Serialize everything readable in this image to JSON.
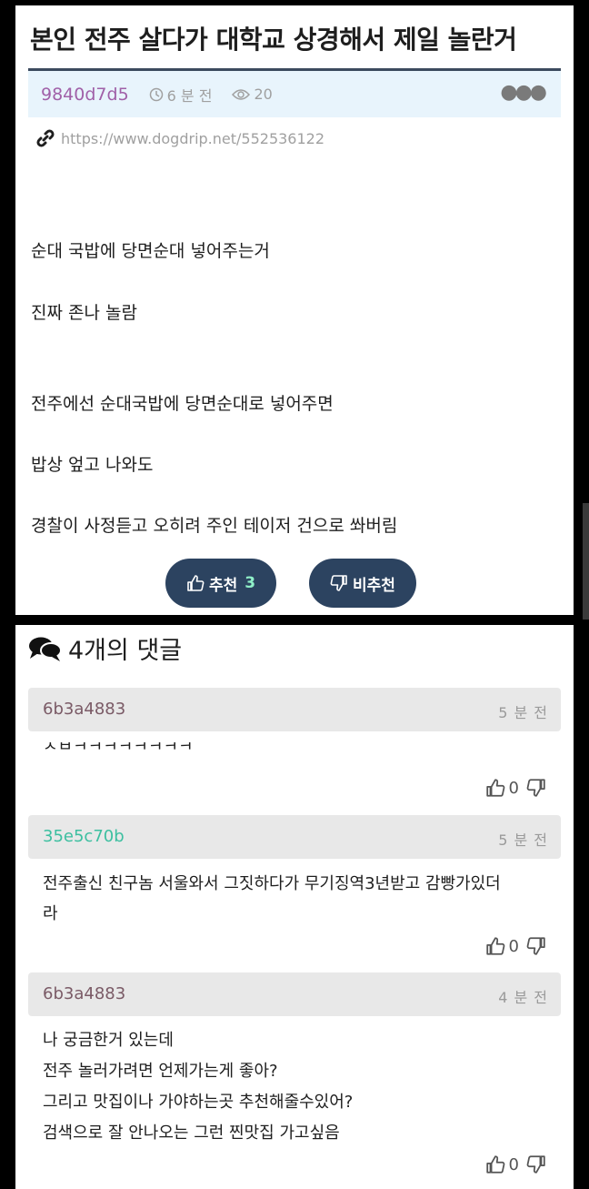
{
  "post": {
    "title": "본인 전주 살다가 대학교 상경해서 제일 놀란거",
    "author": "9840d7d5",
    "time": "6 분 전",
    "views": "20",
    "link": "https://www.dogdrip.net/552536122",
    "body": [
      "순대 국밥에 당면순대 넣어주는거",
      "진짜 존나 놀람",
      "전주에선 순대국밥에 당면순대로 넣어주면",
      "밥상 엎고 나와도",
      "경찰이 사정듣고 오히려 주인 테이저 건으로 쏴버림"
    ],
    "upvote_label": "추천",
    "upvote_count": "3",
    "downvote_label": "비추천"
  },
  "comments_title": "4개의 댓글",
  "comments": [
    {
      "author": "6b3a4883",
      "author_color": "#7a5a66",
      "time": "5 분 전",
      "lines": [
        "ㅅㅂㅋㅋㅋㅋㅋㅋㅋㅋ"
      ],
      "likes": "0"
    },
    {
      "author": "35e5c70b",
      "author_color": "#3cbfa0",
      "time": "5 분 전",
      "lines": [
        "전주출신 친구놈 서울와서 그짓하다가 무기징역3년받고 감빵가있더",
        "라"
      ],
      "likes": "0"
    },
    {
      "author": "6b3a4883",
      "author_color": "#7a5a66",
      "time": "4 분 전",
      "lines": [
        "나 궁금한거 있는데",
        "전주 놀러가려면 언제가는게 좋아?",
        "그리고 맛집이나 가야하는곳 추천해줄수있어?",
        "검색으로 잘 안나오는 그런 찐맛집 가고싶음"
      ],
      "likes": "0"
    }
  ],
  "colors": {
    "vote_button": "#2c4360",
    "meta_bar": "#e8f4fc",
    "author_purple": "#a060a8"
  }
}
